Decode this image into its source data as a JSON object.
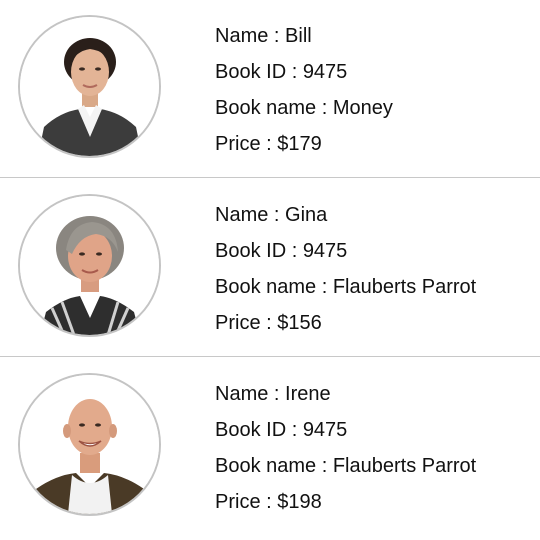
{
  "labels": {
    "name": "Name : ",
    "book_id": "Book ID : ",
    "book_name": "Book name : ",
    "price": "Price : "
  },
  "items": [
    {
      "name": "Bill",
      "book_id": "9475",
      "book_name": "Money",
      "price": "$179",
      "avatar_icon": "woman-dark-hair-portrait"
    },
    {
      "name": "Gina",
      "book_id": "9475",
      "book_name": "Flauberts Parrot",
      "price": "$156",
      "avatar_icon": "woman-gray-hair-portrait"
    },
    {
      "name": "Irene",
      "book_id": "9475",
      "book_name": "Flauberts Parrot",
      "price": "$198",
      "avatar_icon": "bald-man-portrait"
    }
  ],
  "colors": {
    "divider": "#c8c8c8",
    "avatar_border": "#c4c4c4",
    "text": "#111111"
  }
}
